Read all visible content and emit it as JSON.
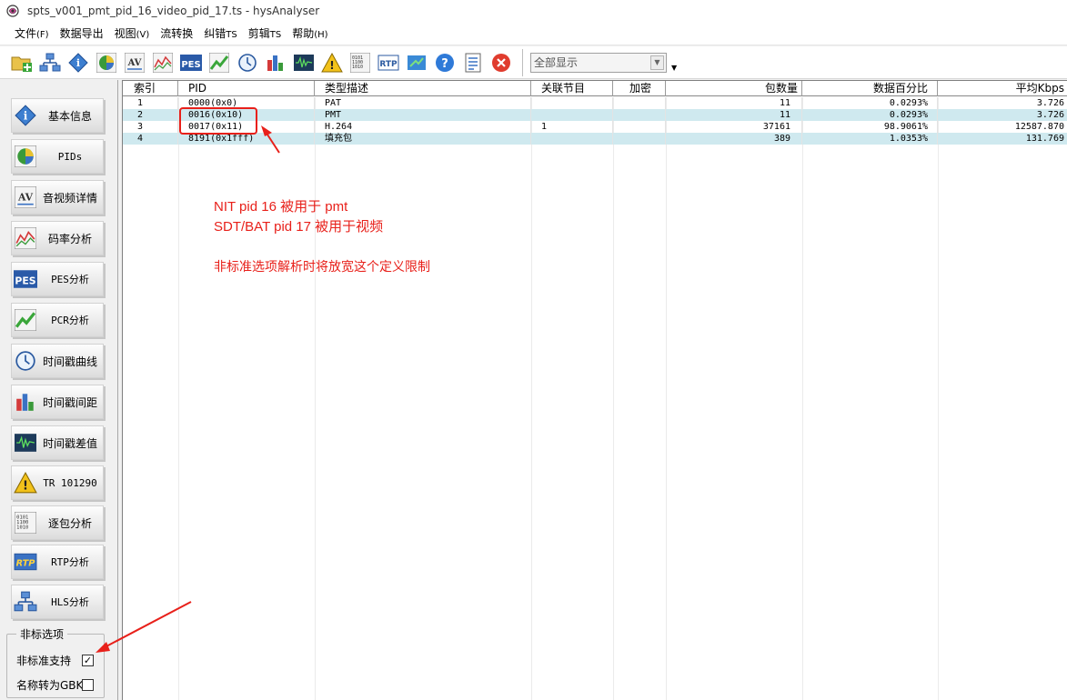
{
  "window": {
    "title": "spts_v001_pmt_pid_16_video_pid_17.ts - hysAnalyser"
  },
  "menu": [
    {
      "label": "文件",
      "mnemonic": "(F)"
    },
    {
      "label": "数据导出",
      "mnemonic": ""
    },
    {
      "label": "视图",
      "mnemonic": "(V)"
    },
    {
      "label": "流转换",
      "mnemonic": ""
    },
    {
      "label": "纠错",
      "mnemonic": "TS"
    },
    {
      "label": "剪辑",
      "mnemonic": "TS"
    },
    {
      "label": "帮助",
      "mnemonic": "(H)"
    }
  ],
  "toolbar": {
    "icons": [
      "open-folder-icon",
      "network-icon",
      "info-icon",
      "pie-chart-icon",
      "av-icon",
      "bitrate-chart-icon",
      "pes-icon",
      "pcr-icon",
      "clock-icon",
      "bar-chart-icon",
      "waveform-icon",
      "warning-icon",
      "binary-icon",
      "rtp-icon",
      "export-icon",
      "help-icon",
      "document-icon",
      "close-circle-icon"
    ],
    "display_select": "全部显示"
  },
  "sidebar": {
    "items": [
      {
        "label": "基本信息",
        "icon": "info-icon"
      },
      {
        "label": "PIDs",
        "icon": "pie-chart-icon"
      },
      {
        "label": "音视频详情",
        "icon": "av-icon"
      },
      {
        "label": "码率分析",
        "icon": "bitrate-chart-icon"
      },
      {
        "label": "PES分析",
        "icon": "pes-icon"
      },
      {
        "label": "PCR分析",
        "icon": "pcr-icon"
      },
      {
        "label": "时间戳曲线",
        "icon": "clock-icon"
      },
      {
        "label": "时间戳间距",
        "icon": "bar-chart-icon"
      },
      {
        "label": "时间戳差值",
        "icon": "waveform-icon"
      },
      {
        "label": "TR 101290",
        "icon": "warning-icon"
      },
      {
        "label": "逐包分析",
        "icon": "binary-icon"
      },
      {
        "label": "RTP分析",
        "icon": "rtp-icon"
      },
      {
        "label": "HLS分析",
        "icon": "network-icon"
      }
    ],
    "options": {
      "legend": "非标选项",
      "nonstandard_label": "非标准支持",
      "nonstandard_checked": true,
      "gbk_label": "名称转为GBK",
      "gbk_checked": false
    }
  },
  "table": {
    "columns": [
      "索引",
      "PID",
      "类型描述",
      "关联节目",
      "加密",
      "包数量",
      "数据百分比",
      "平均Kbps"
    ],
    "rows": [
      {
        "index": "1",
        "pid": "0000(0x0)",
        "type": "PAT",
        "program": "",
        "encrypt": "",
        "packets": "11",
        "percent": "0.0293%",
        "kbps": "3.726"
      },
      {
        "index": "2",
        "pid": "0016(0x10)",
        "type": "PMT",
        "program": "",
        "encrypt": "",
        "packets": "11",
        "percent": "0.0293%",
        "kbps": "3.726"
      },
      {
        "index": "3",
        "pid": "0017(0x11)",
        "type": "H.264",
        "program": "1",
        "encrypt": "",
        "packets": "37161",
        "percent": "98.9061%",
        "kbps": "12587.870"
      },
      {
        "index": "4",
        "pid": "8191(0x1fff)",
        "type": "填充包",
        "program": "",
        "encrypt": "",
        "packets": "389",
        "percent": "1.0353%",
        "kbps": "131.769"
      }
    ]
  },
  "annotations": {
    "line1": "NIT pid 16 被用于 pmt",
    "line2": "SDT/BAT pid 17 被用于视频",
    "line3": "非标准选项解析时将放宽这个定义限制",
    "color": "#e8201a"
  }
}
